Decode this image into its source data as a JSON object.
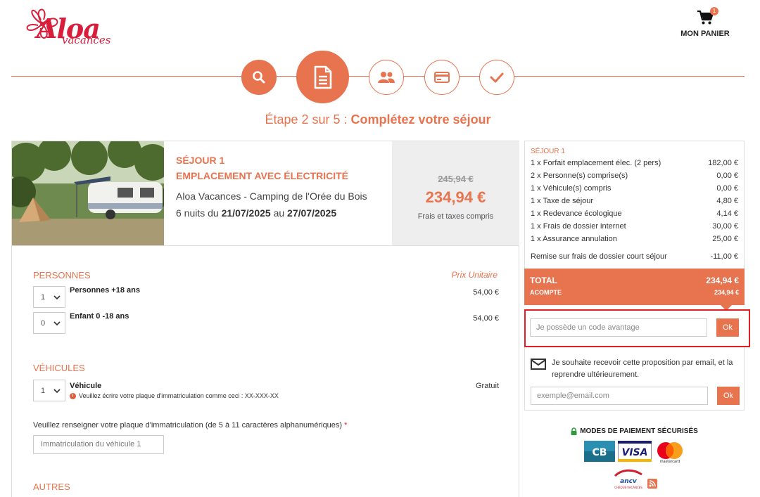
{
  "header": {
    "logo_text": "Aloa",
    "logo_sub": "vacances",
    "cart_count": "1",
    "cart_label": "MON PANIER"
  },
  "stepper": {
    "steps": [
      "search-icon",
      "document-icon",
      "users-icon",
      "payment-card-icon",
      "check-icon"
    ],
    "title_prefix": "Étape 2 sur 5 : ",
    "title_main": "Complétez votre séjour"
  },
  "stay": {
    "label": "SÉJOUR 1",
    "type": "EMPLACEMENT AVEC ÉLECTRICITÉ",
    "camp": "Aloa Vacances - Camping de l'Orée du Bois",
    "dates_prefix": "6 nuits du ",
    "date_from": "21/07/2025",
    "dates_mid": " au ",
    "date_to": "27/07/2025",
    "price_old": "245,94 €",
    "price_new": "234,94 €",
    "price_note": "Frais et taxes compris"
  },
  "persons": {
    "title": "PERSONNES",
    "unit_header": "Prix Unitaire",
    "rows": [
      {
        "qty": "1",
        "label": "Personnes +18 ans",
        "price": "54,00 €"
      },
      {
        "qty": "0",
        "label": "Enfant 0 -18 ans",
        "price": "54,00 €"
      }
    ]
  },
  "vehicles": {
    "title": "VÉHICULES",
    "qty": "1",
    "label": "Véhicule",
    "price": "Gratuit",
    "warning": "Veuillez écrire votre plaque d'immatriculation comme ceci : XX-XXX-XX",
    "plate_label": "Veuillez renseigner votre plaque d'immatriculation (de 5 à 11 caractères alphanumériques)",
    "plate_required": "*",
    "plate_placeholder": "Immatriculation du véhicule 1"
  },
  "others": {
    "title": "AUTRES"
  },
  "summary": {
    "head": "SÉJOUR 1",
    "lines": [
      {
        "label": "1 x Forfait emplacement élec. (2 pers)",
        "value": "182,00 €"
      },
      {
        "label": "2 x Personne(s) comprise(s)",
        "value": "0,00 €"
      },
      {
        "label": "1 x Véhicule(s) compris",
        "value": "0,00 €"
      },
      {
        "label": "1 x Taxe de séjour",
        "value": "4,80 €"
      },
      {
        "label": "1 x Redevance écologique",
        "value": "4,14 €"
      },
      {
        "label": "1 x Frais de dossier internet",
        "value": "30,00 €"
      },
      {
        "label": "1 x Assurance annulation",
        "value": "25,00 €"
      }
    ],
    "discount": {
      "label": "Remise sur frais de dossier court séjour",
      "value": "-11,00 €"
    },
    "total_label": "TOTAL",
    "total_value": "234,94 €",
    "deposit_label": "ACOMPTE",
    "deposit_value": "234,94 €"
  },
  "promo": {
    "placeholder": "Je possède un code avantage",
    "button": "Ok"
  },
  "email": {
    "text": "Je souhaite recevoir cette proposition par email, et la reprendre ultérieurement.",
    "placeholder": "exemple@email.com",
    "button": "Ok"
  },
  "payment": {
    "title": "MODES DE PAIEMENT SÉCURISÉS",
    "logos": [
      "CB",
      "VISA",
      "mastercard",
      "ancv"
    ],
    "ancv_sub": "CHÈQUE-VACANCES"
  },
  "colors": {
    "accent": "#e8734f",
    "highlight": "#e01e24"
  }
}
